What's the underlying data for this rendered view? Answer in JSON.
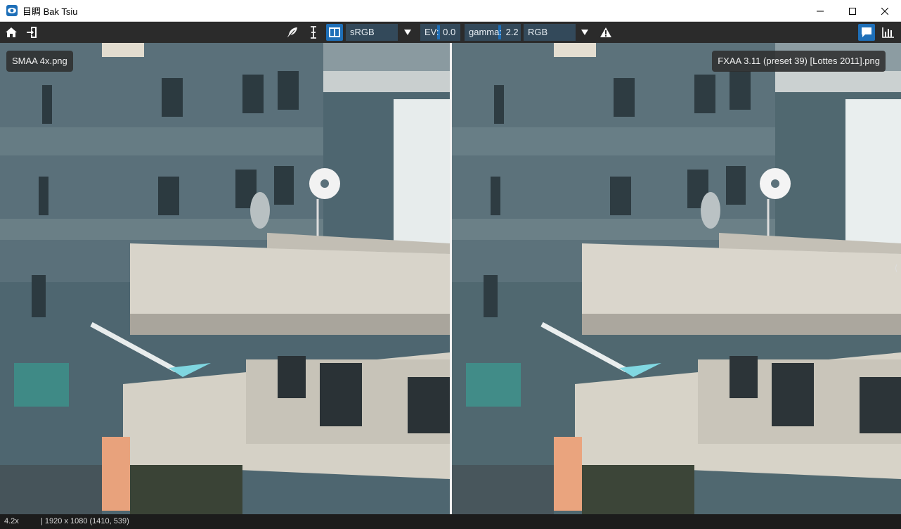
{
  "window": {
    "title": "目睭 Bak Tsiu",
    "controls": [
      "minimize",
      "maximize",
      "close"
    ]
  },
  "toolbar": {
    "left_icons": [
      "home-icon",
      "open-file-icon"
    ],
    "center_icons": [
      "feather-icon",
      "text-cursor-icon",
      "split-view-icon"
    ],
    "colorspace": "sRGB",
    "ev_label": "EV:",
    "ev_value": "0.0",
    "gamma_label": "gamma:",
    "gamma_value": "2.2",
    "channel": "RGB",
    "warning_icon": "warning-icon",
    "right_icons": [
      "comment-icon",
      "histogram-icon"
    ],
    "accent_color": "#1e6fb8"
  },
  "viewer": {
    "left_image_label": "SMAA 4x.png",
    "right_image_label": "FXAA 3.11 (preset 39) [Lottes 2011].png",
    "side_handle": "⟨"
  },
  "status": {
    "zoom": "4.2x",
    "info": "| 1920 x 1080  (1410, 539)"
  }
}
